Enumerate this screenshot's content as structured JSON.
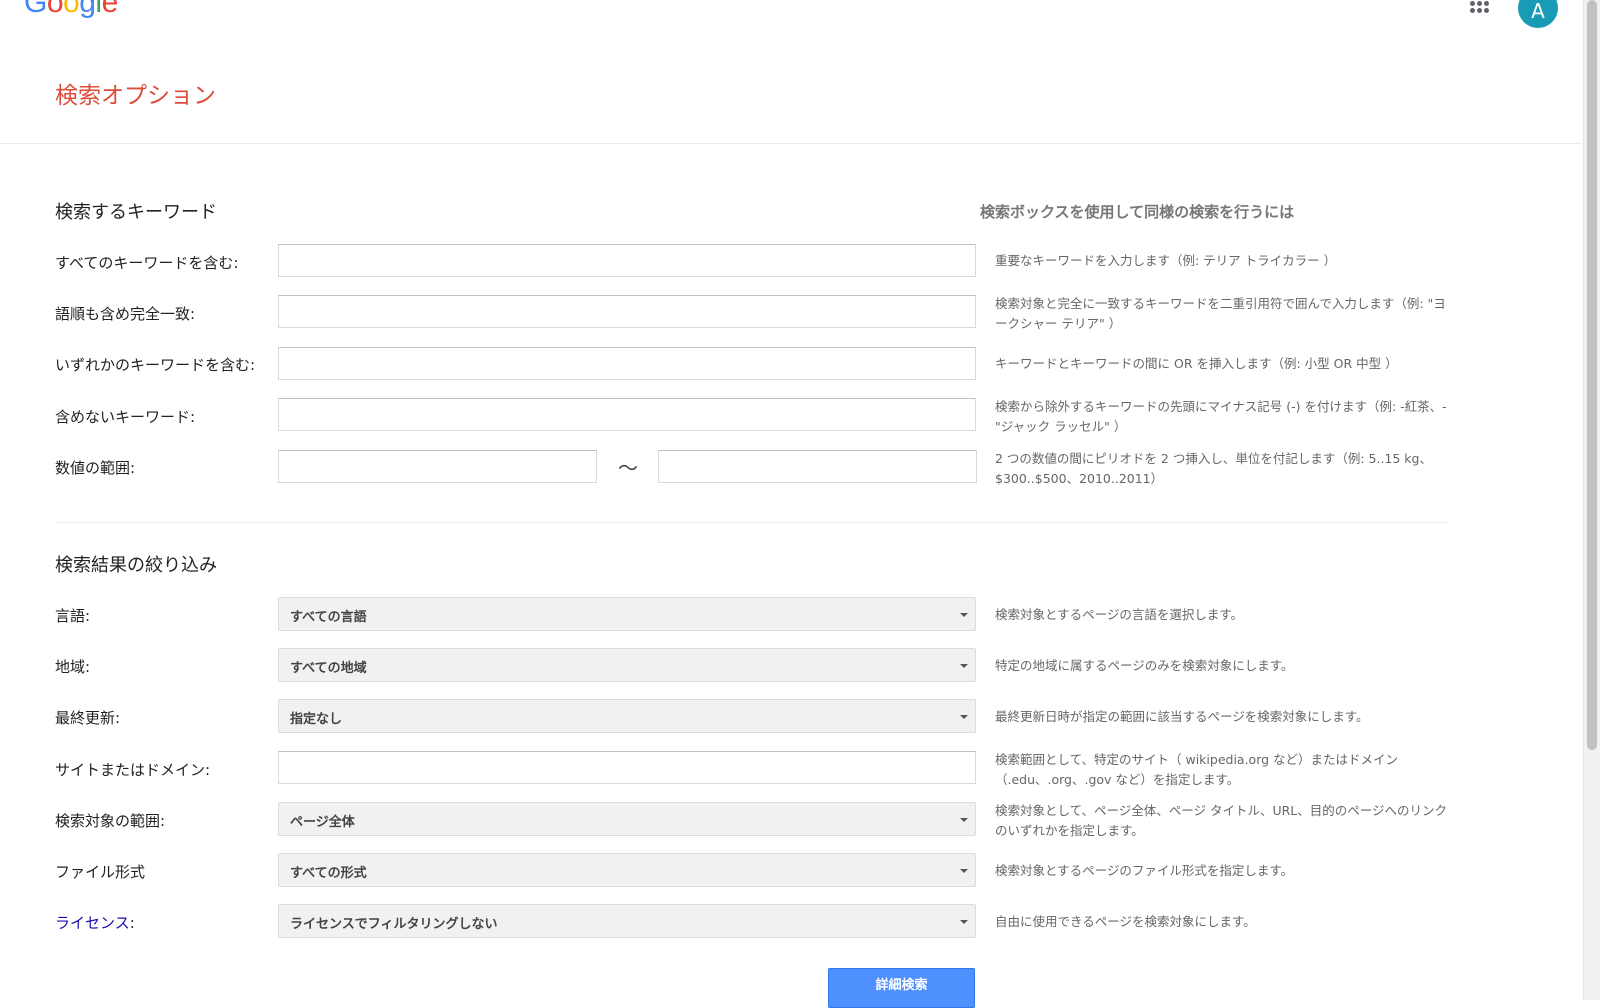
{
  "header": {
    "logo": {
      "letters": [
        "G",
        "o",
        "o",
        "g",
        "l",
        "e"
      ],
      "colors": [
        "#4285f4",
        "#ea4335",
        "#fbbc05",
        "#4285f4",
        "#34a853",
        "#ea4335"
      ]
    },
    "apps_icon": "apps-grid-icon",
    "avatar_letter": "A",
    "avatar_color": "#1a9bb5"
  },
  "page_title": "検索オプション",
  "keywords_section": {
    "title": "検索するキーワード",
    "howto_title": "検索ボックスを使用して同様の検索を行うには",
    "rows": [
      {
        "label": "すべてのキーワードを含む:",
        "value": "",
        "hint": "重要なキーワードを入力します（例: テリア トライカラー ）"
      },
      {
        "label": "語順も含め完全一致:",
        "value": "",
        "hint": "検索対象と完全に一致するキーワードを二重引用符で囲んで入力します（例: \"ヨークシャー テリア\" ）"
      },
      {
        "label": "いずれかのキーワードを含む:",
        "value": "",
        "hint": "キーワードとキーワードの間に OR を挿入します（例: 小型 OR 中型 ）"
      },
      {
        "label": "含めないキーワード:",
        "value": "",
        "hint": "検索から除外するキーワードの先頭にマイナス記号 (-) を付けます（例: -紅茶、-\"ジャック ラッセル\" ）"
      }
    ],
    "range": {
      "label": "数値の範囲:",
      "from": "",
      "separator": "〜",
      "to": "",
      "hint": "2 つの数値の間にピリオドを 2 つ挿入し、単位を付記します（例: 5..15 kg、$300..$500、2010..2011）"
    }
  },
  "filter_section": {
    "title": "検索結果の絞り込み",
    "language": {
      "label": "言語:",
      "selected": "すべての言語",
      "hint": "検索対象とするページの言語を選択します。"
    },
    "region": {
      "label": "地域:",
      "selected": "すべての地域",
      "hint": "特定の地域に属するページのみを検索対象にします。"
    },
    "last_update": {
      "label": "最終更新:",
      "selected": "指定なし",
      "hint": "最終更新日時が指定の範囲に該当するページを検索対象にします。"
    },
    "site": {
      "label": "サイトまたはドメイン:",
      "value": "",
      "hint": "検索範囲として、特定のサイト（ wikipedia.org など）またはドメイン（.edu、.org、.gov など）を指定します。"
    },
    "terms_appearing": {
      "label": "検索対象の範囲:",
      "selected": "ページ全体",
      "hint": "検索対象として、ページ全体、ページ タイトル、URL、目的のページへのリンクのいずれかを指定します。"
    },
    "file_type": {
      "label": "ファイル形式",
      "selected": "すべての形式",
      "hint": "検索対象とするページのファイル形式を指定します。"
    },
    "license": {
      "label": "ライセンス",
      "colon": ":",
      "selected": "ライセンスでフィルタリングしない",
      "hint": "自由に使用できるページを検索対象にします。"
    }
  },
  "submit_label": "詳細検索"
}
